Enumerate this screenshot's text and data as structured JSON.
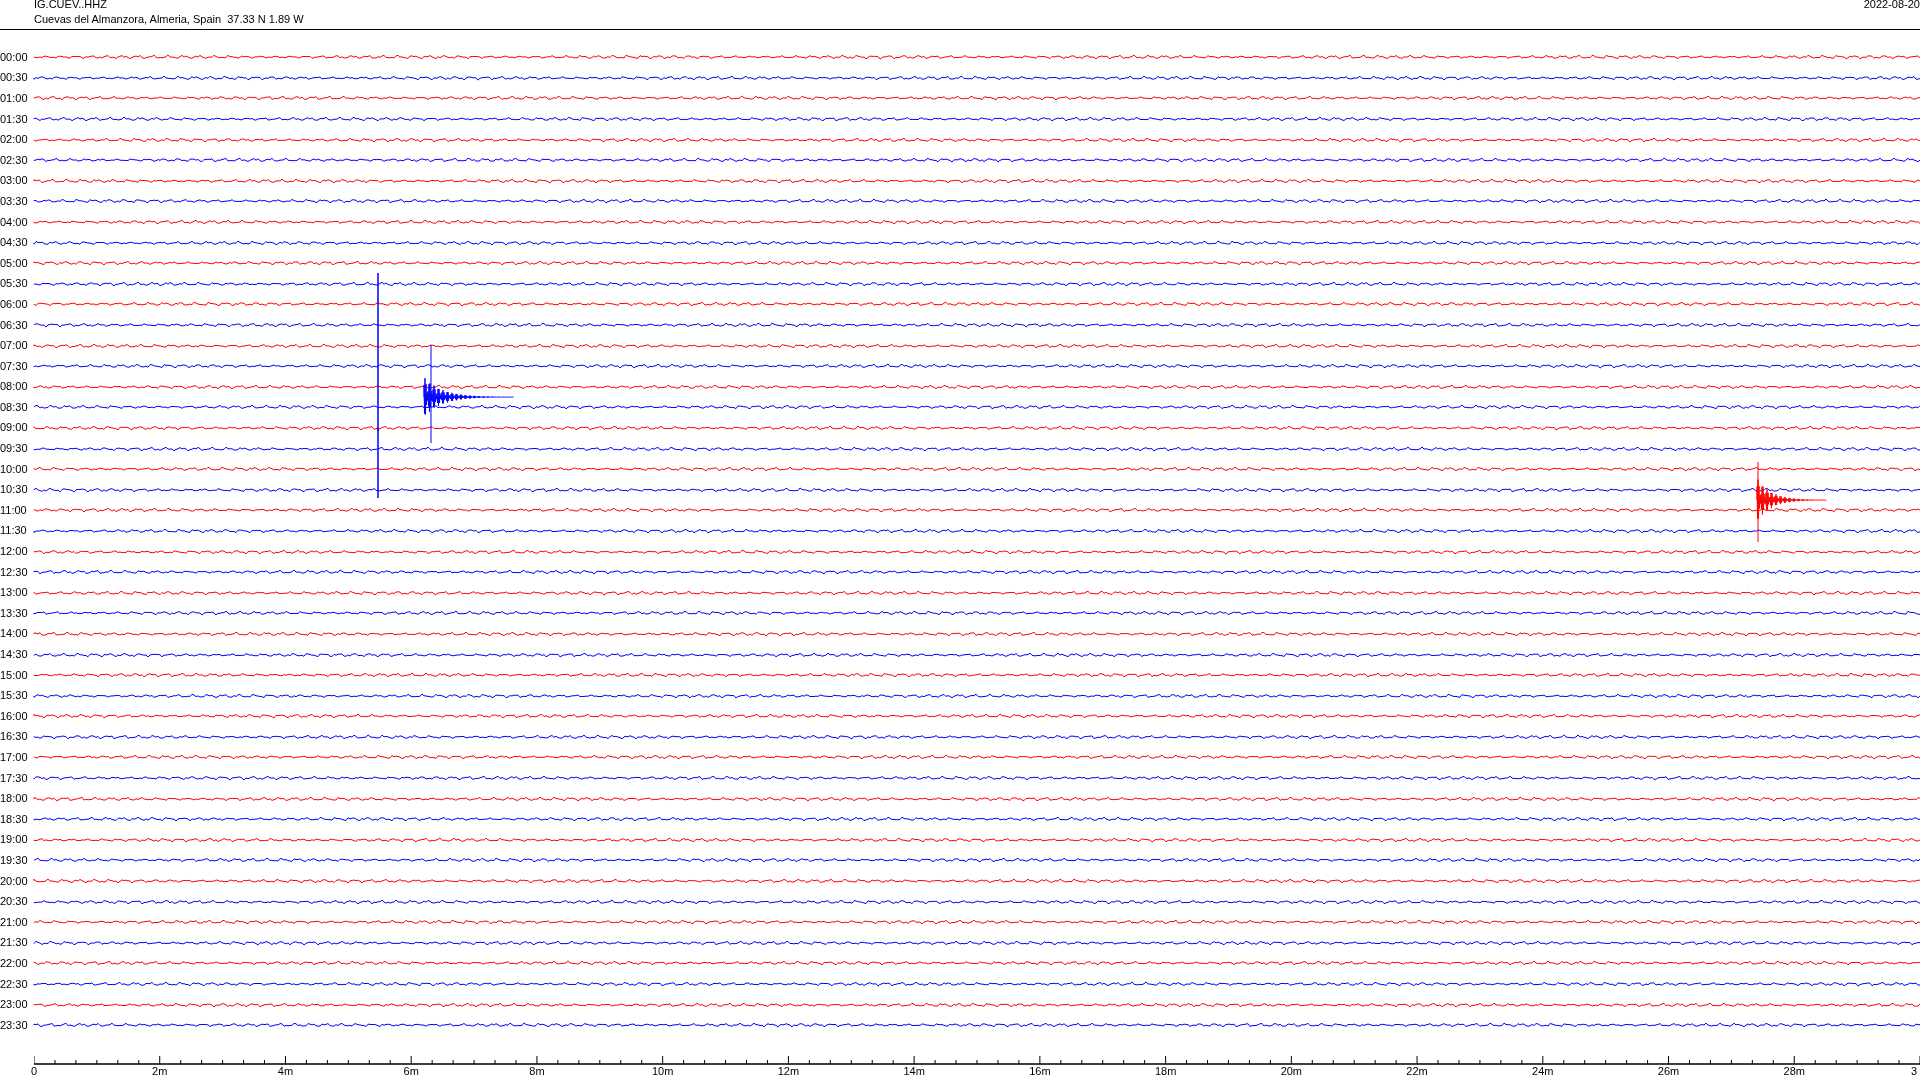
{
  "header": {
    "station": "IG.CUEV..HHZ",
    "location": "Cuevas del Almanzora, Almeria, Spain  37.33 N 1.89 W",
    "date": "2022-08-20"
  },
  "traces": [
    {
      "time": "00:00",
      "color": "#ff0000"
    },
    {
      "time": "00:30",
      "color": "#0000ff"
    },
    {
      "time": "01:00",
      "color": "#ff0000"
    },
    {
      "time": "01:30",
      "color": "#0000ff"
    },
    {
      "time": "02:00",
      "color": "#ff0000"
    },
    {
      "time": "02:30",
      "color": "#0000ff"
    },
    {
      "time": "03:00",
      "color": "#ff0000"
    },
    {
      "time": "03:30",
      "color": "#0000ff"
    },
    {
      "time": "04:00",
      "color": "#ff0000"
    },
    {
      "time": "04:30",
      "color": "#0000ff"
    },
    {
      "time": "05:00",
      "color": "#ff0000"
    },
    {
      "time": "05:30",
      "color": "#0000ff"
    },
    {
      "time": "06:00",
      "color": "#ff0000"
    },
    {
      "time": "06:30",
      "color": "#0000ff"
    },
    {
      "time": "07:00",
      "color": "#ff0000"
    },
    {
      "time": "07:30",
      "color": "#0000ff"
    },
    {
      "time": "08:00",
      "color": "#ff0000"
    },
    {
      "time": "08:30",
      "color": "#0000ff"
    },
    {
      "time": "09:00",
      "color": "#ff0000"
    },
    {
      "time": "09:30",
      "color": "#0000ff"
    },
    {
      "time": "10:00",
      "color": "#ff0000"
    },
    {
      "time": "10:30",
      "color": "#0000ff"
    },
    {
      "time": "11:00",
      "color": "#ff0000"
    },
    {
      "time": "11:30",
      "color": "#0000ff"
    },
    {
      "time": "12:00",
      "color": "#ff0000"
    },
    {
      "time": "12:30",
      "color": "#0000ff"
    },
    {
      "time": "13:00",
      "color": "#ff0000"
    },
    {
      "time": "13:30",
      "color": "#0000ff"
    },
    {
      "time": "14:00",
      "color": "#ff0000"
    },
    {
      "time": "14:30",
      "color": "#0000ff"
    },
    {
      "time": "15:00",
      "color": "#ff0000"
    },
    {
      "time": "15:30",
      "color": "#0000ff"
    },
    {
      "time": "16:00",
      "color": "#ff0000"
    },
    {
      "time": "16:30",
      "color": "#0000ff"
    },
    {
      "time": "17:00",
      "color": "#ff0000"
    },
    {
      "time": "17:30",
      "color": "#0000ff"
    },
    {
      "time": "18:00",
      "color": "#ff0000"
    },
    {
      "time": "18:30",
      "color": "#0000ff"
    },
    {
      "time": "19:00",
      "color": "#ff0000"
    },
    {
      "time": "19:30",
      "color": "#0000ff"
    },
    {
      "time": "20:00",
      "color": "#ff0000"
    },
    {
      "time": "20:30",
      "color": "#0000ff"
    },
    {
      "time": "21:00",
      "color": "#ff0000"
    },
    {
      "time": "21:30",
      "color": "#0000ff"
    },
    {
      "time": "22:00",
      "color": "#ff0000"
    },
    {
      "time": "22:30",
      "color": "#0000ff"
    },
    {
      "time": "23:00",
      "color": "#ff0000"
    },
    {
      "time": "23:30",
      "color": "#0000ff"
    }
  ],
  "axis_labels": [
    "0",
    "2m",
    "4m",
    "6m",
    "8m",
    "10m",
    "12m",
    "14m",
    "16m",
    "18m",
    "20m",
    "22m",
    "24m",
    "26m",
    "28m",
    "3"
  ]
}
